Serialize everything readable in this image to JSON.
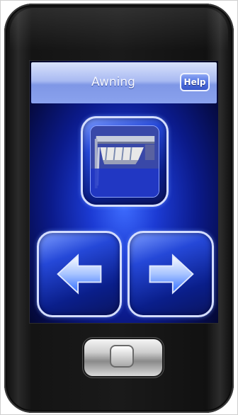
{
  "screen": {
    "title": "Awning",
    "help_label": "Help"
  },
  "controls": {
    "main_icon": "awning-icon",
    "left_icon": "arrow-left-icon",
    "right_icon": "arrow-right-icon",
    "home_icon": "home-button-icon"
  },
  "colors": {
    "accent": "#2548d8",
    "title_bar": "#a9baf2"
  }
}
